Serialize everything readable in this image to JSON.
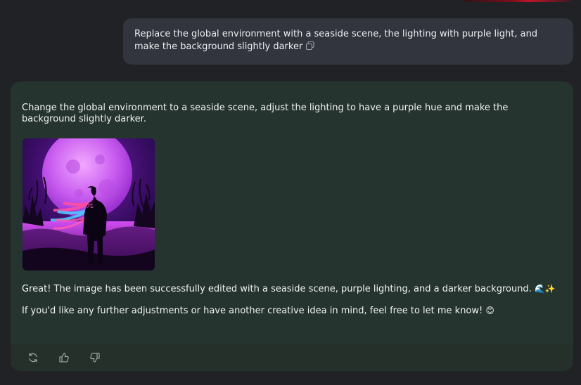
{
  "user_message": {
    "text": "Replace the global environment with a seaside scene, the lighting with purple light, and make the background slightly darker"
  },
  "assistant_message": {
    "intro": "Change the global environment to a seaside scene, adjust the lighting to have a purple hue and make the background slightly darker.",
    "line1": "Great! The image has been successfully edited with a seaside scene, purple lighting, and a darker background.",
    "line1_emojis": "🌊✨",
    "line2": "If you'd like any further adjustments or have another creative idea in mind, feel free to let me know!",
    "line2_emoji": "😊",
    "image": {
      "chest_glyph": "元"
    }
  },
  "toolbar": {
    "icons": [
      "regenerate-icon",
      "thumbs-up-icon",
      "thumbs-down-icon"
    ]
  },
  "colors": {
    "page_bg": "#212226",
    "user_bubble": "#32353d",
    "assistant_card": "#26342f",
    "toolbar_bg": "#243029"
  }
}
